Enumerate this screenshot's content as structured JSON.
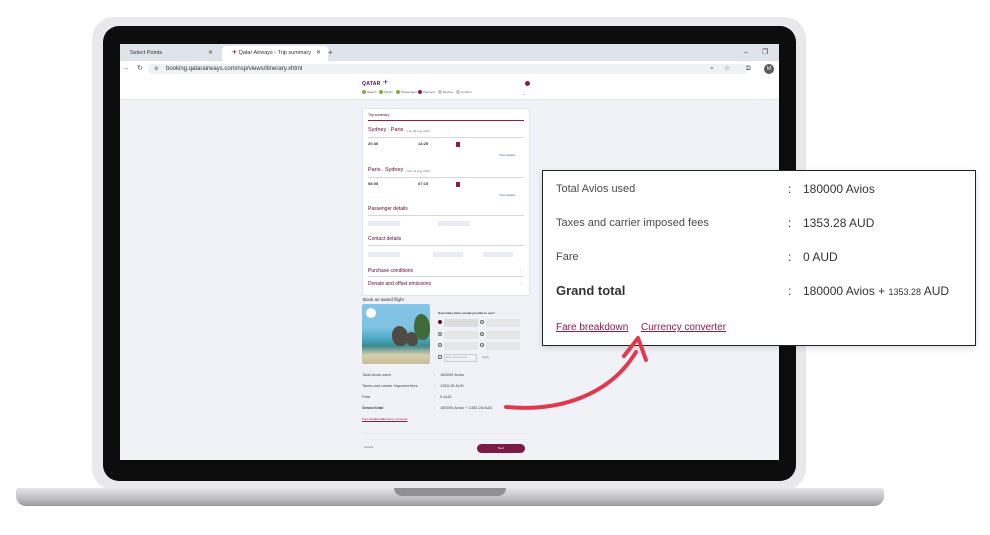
{
  "browser": {
    "tabs": [
      {
        "label": "Select Points"
      },
      {
        "label": "Qatar Airways - Trip summary"
      }
    ],
    "new_tab": "+",
    "url": "booking.qatarairways.com/nsp/views/itinerary.xhtml",
    "avatar_initial": "M"
  },
  "site": {
    "logo_text": "QATAR",
    "steps": [
      "Search",
      "Flights",
      "Passengers",
      "Payment",
      "Review",
      "Confirm"
    ]
  },
  "trip": {
    "heading": "Trip summary",
    "outbound": {
      "route_from": "Sydney",
      "route_to": "Paris",
      "date": "Tue 06 Aug 2024",
      "depart": "20:40",
      "arrive": "14:25",
      "details": "View details"
    },
    "inbound": {
      "route_from": "Paris",
      "route_to": "Sydney",
      "date": "Sun 11 Aug 2024",
      "depart": "08:05",
      "arrive": "07:15",
      "details": "View details"
    }
  },
  "sections": {
    "passenger_details": "Passenger details",
    "contact_details": "Contact details",
    "purchase_conditions": "Purchase conditions",
    "donate": "Donate and offset emissions"
  },
  "award": {
    "heading": "Book an award flight",
    "question": "How many Avios would you like to use?",
    "input_placeholder": "Enter Avios to use",
    "apply": "Apply"
  },
  "totals": {
    "avios_label": "Total Avios used",
    "avios_value": "180000 Avios",
    "taxes_label": "Taxes and carrier imposed fees",
    "taxes_value": "1353.28 AUD",
    "fare_label": "Fare",
    "fare_value": "0 AUD",
    "grand_label": "Grand total",
    "grand_value": "180000 Avios + 1353.28 AUD",
    "grand_avios": "180000 Avios + ",
    "grand_amount": "1353.28",
    "grand_currency": "AUD",
    "separator": ":",
    "fare_breakdown": "Fare breakdown",
    "currency_converter": "Currency converter"
  },
  "footer": {
    "back": "Cancel",
    "next": "Next"
  },
  "colors": {
    "brand": "#5c0632",
    "accent": "#8e1d46",
    "arrow": "#e2384b"
  }
}
